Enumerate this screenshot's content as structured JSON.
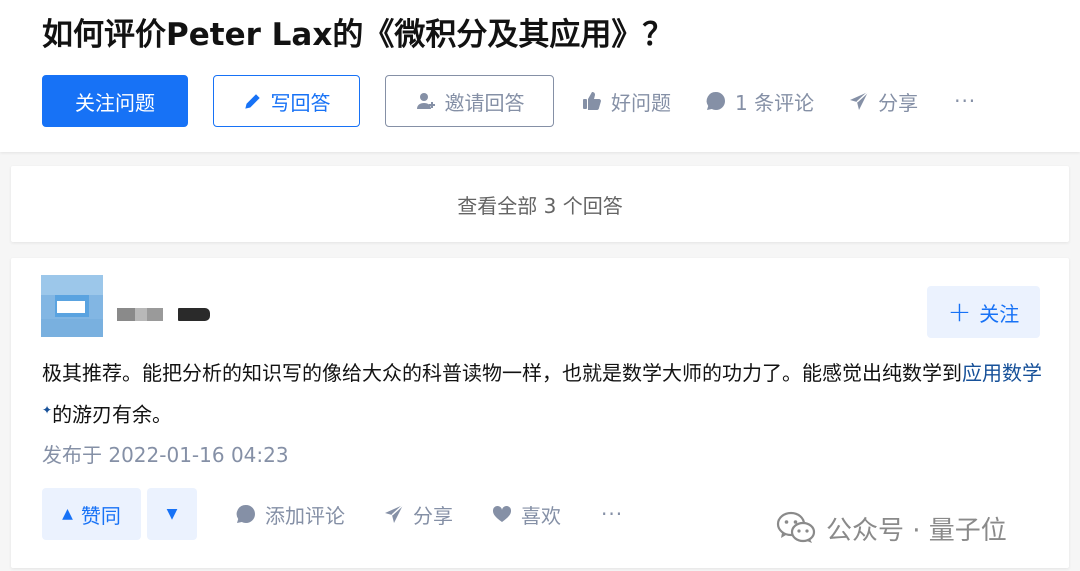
{
  "question": {
    "title": "如何评价Peter Lax的《微积分及其应用》？",
    "follow_label": "关注问题",
    "write_answer_label": "写回答",
    "invite_label": "邀请回答",
    "good_question_label": "好问题",
    "comments_label": "1 条评论",
    "share_label": "分享",
    "more_label": "···"
  },
  "view_all": {
    "label": "查看全部 3 个回答"
  },
  "answer": {
    "follow_label": "关注",
    "content_before_link": "极其推荐。能把分析的知识写的像给大众的科普读物一样，也就是数学大师的功力了。能感觉出纯数学到",
    "content_link": "应用数学",
    "content_link_mark": "✦",
    "content_after_link": "的游刃有余。",
    "published": "发布于 2022-01-16 04:23",
    "upvote_label": "赞同",
    "add_comment_label": "添加评论",
    "share_label": "分享",
    "like_label": "喜欢",
    "more_label": "···"
  },
  "watermark": {
    "text": "公众号 · 量子位"
  },
  "colors": {
    "brand_blue": "#1772f6",
    "muted_grey": "#8590a6",
    "link_blue": "#175199",
    "page_bg": "#f6f6f6"
  }
}
